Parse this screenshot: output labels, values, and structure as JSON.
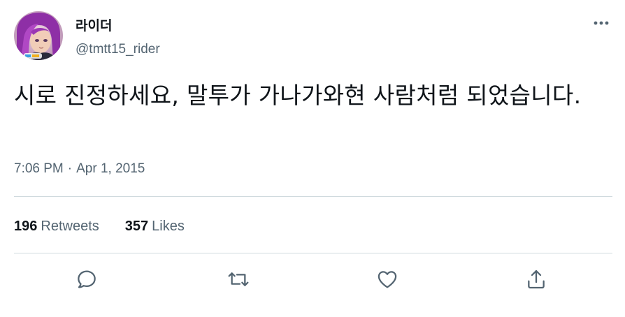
{
  "user": {
    "display_name": "라이더",
    "handle": "@tmtt15_rider",
    "avatar_icon": "avatar-purple-hair"
  },
  "tweet": {
    "text": "시로 진정하세요, 말투가 가나가와현 사람처럼 되었습니다.",
    "time": "7:06 PM",
    "separator": "·",
    "date": "Apr 1, 2015"
  },
  "stats": {
    "retweets_count": "196",
    "retweets_label": "Retweets",
    "likes_count": "357",
    "likes_label": "Likes"
  },
  "actions": {
    "reply_icon": "reply-icon",
    "retweet_icon": "retweet-icon",
    "like_icon": "heart-icon",
    "share_icon": "share-icon"
  },
  "colors": {
    "text_primary": "#0f1419",
    "text_secondary": "#536471",
    "divider": "#cfd9de"
  }
}
